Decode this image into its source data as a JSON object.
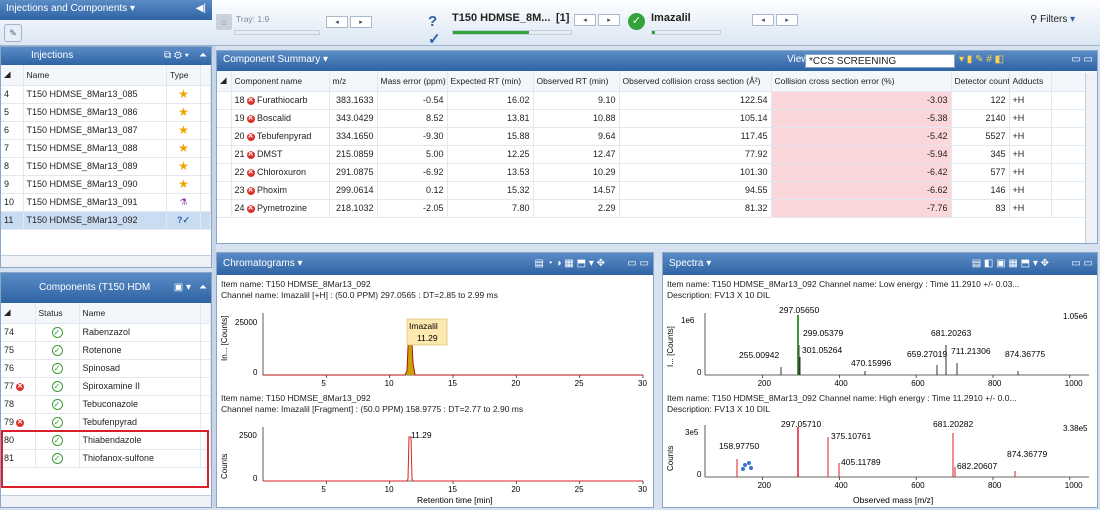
{
  "toolbar": {
    "tray_label": "Tray: 1:9",
    "injection_title": "T150 HDMSE_8M...",
    "injection_index": "[1]",
    "component_title": "Imazalil",
    "filters_label": "Filters"
  },
  "injections_panel": {
    "outer_title": "Injections and Components",
    "title": "Injections",
    "col_name": "Name",
    "col_type": "Type",
    "rows": [
      {
        "idx": "4",
        "name": "T150 HDMSE_8Mar13_085"
      },
      {
        "idx": "5",
        "name": "T150 HDMSE_8Mar13_086"
      },
      {
        "idx": "6",
        "name": "T150 HDMSE_8Mar13_087"
      },
      {
        "idx": "7",
        "name": "T150 HDMSE_8Mar13_088"
      },
      {
        "idx": "8",
        "name": "T150 HDMSE_8Mar13_089"
      },
      {
        "idx": "9",
        "name": "T150 HDMSE_8Mar13_090"
      },
      {
        "idx": "10",
        "name": "T150 HDMSE_8Mar13_091"
      },
      {
        "idx": "11",
        "name": "T150 HDMSE_8Mar13_092"
      }
    ]
  },
  "components_panel": {
    "title": "Components (T150 HDM",
    "col_status": "Status",
    "col_name": "Name",
    "rows": [
      {
        "idx": "74",
        "name": "Rabenzazol"
      },
      {
        "idx": "75",
        "name": "Rotenone"
      },
      {
        "idx": "76",
        "name": "Spinosad"
      },
      {
        "idx": "77",
        "name": "Spiroxamine II"
      },
      {
        "idx": "78",
        "name": "Tebuconazole"
      },
      {
        "idx": "79",
        "name": "Tebufenpyrad"
      },
      {
        "idx": "80",
        "name": "Thiabendazole"
      },
      {
        "idx": "81",
        "name": "Thiofanox-sulfone"
      }
    ]
  },
  "summary": {
    "title": "Component Summary",
    "view_label": "View:",
    "view_value": "*CCS SCREENING",
    "columns": [
      "Component name",
      "m/z",
      "Mass error (ppm)",
      "Expected RT (min)",
      "Observed RT (min)",
      "Observed collision cross section (Å²)",
      "Collision cross section error (%)",
      "Detector counts",
      "Adducts"
    ],
    "rows": [
      {
        "idx": "18",
        "name": "Furathiocarb",
        "mz": "383.1633",
        "me": "-0.54",
        "ert": "16.02",
        "ort": "9.10",
        "ccs": "122.54",
        "ccserr": "-3.03",
        "counts": "122",
        "adduct": "+H"
      },
      {
        "idx": "19",
        "name": "Boscalid",
        "mz": "343.0429",
        "me": "8.52",
        "ert": "13.81",
        "ort": "10.88",
        "ccs": "105.14",
        "ccserr": "-5.38",
        "counts": "2140",
        "adduct": "+H"
      },
      {
        "idx": "20",
        "name": "Tebufenpyrad",
        "mz": "334.1650",
        "me": "-9.30",
        "ert": "15.88",
        "ort": "9.64",
        "ccs": "117.45",
        "ccserr": "-5.42",
        "counts": "5527",
        "adduct": "+H"
      },
      {
        "idx": "21",
        "name": "DMST",
        "mz": "215.0859",
        "me": "5.00",
        "ert": "12.25",
        "ort": "12.47",
        "ccs": "77.92",
        "ccserr": "-5.94",
        "counts": "345",
        "adduct": "+H"
      },
      {
        "idx": "22",
        "name": "Chloroxuron",
        "mz": "291.0875",
        "me": "-6.92",
        "ert": "13.53",
        "ort": "10.29",
        "ccs": "101.30",
        "ccserr": "-6.42",
        "counts": "577",
        "adduct": "+H"
      },
      {
        "idx": "23",
        "name": "Phoxim",
        "mz": "299.0614",
        "me": "0.12",
        "ert": "15.32",
        "ort": "14.57",
        "ccs": "94.55",
        "ccserr": "-6.62",
        "counts": "146",
        "adduct": "+H"
      },
      {
        "idx": "24",
        "name": "Pymetrozine",
        "mz": "218.1032",
        "me": "-2.05",
        "ert": "7.80",
        "ort": "2.29",
        "ccs": "81.32",
        "ccserr": "-7.76",
        "counts": "83",
        "adduct": "+H"
      }
    ]
  },
  "chromatograms": {
    "title": "Chromatograms",
    "plot1": {
      "item": "Item name: T150 HDMSE_8Mar13_092",
      "channel": "Channel name: Imazalil [+H] : (50.0 PPM) 297.0565 : DT=2.85 to 2.99 ms",
      "ylabel": "In... [Counts]",
      "ytick": "25000",
      "yzero": "0",
      "peak_label": "Imazalil",
      "peak_value": "11.29"
    },
    "plot2": {
      "item": "Item name: T150 HDMSE_8Mar13_092",
      "channel": "Channel name: Imazalil [Fragment] : (50.0 PPM) 158.9775 : DT=2.77 to 2.90 ms",
      "ylabel": "Counts",
      "ytick": "2500",
      "yzero": "0",
      "peak_value": "11.29"
    },
    "xticks": [
      "5",
      "10",
      "15",
      "20",
      "25",
      "30"
    ],
    "xlabel": "Retention time [min]"
  },
  "spectra": {
    "title": "Spectra",
    "plot1": {
      "item": "Item name: T150 HDMSE_8Mar13_092   Channel name: Low energy : Time 11.2910 +/- 0.03...",
      "desc": "Description: FV13 X 10 DIL",
      "ylabel": "I... [Counts]",
      "ytick": "1e6",
      "yzero": "0",
      "max": "1.05e6",
      "labels": [
        "297.05650",
        "299.05379",
        "301.05264",
        "255.00942",
        "470.15996",
        "659.27019",
        "681.20263",
        "711.21306",
        "874.36775"
      ]
    },
    "plot2": {
      "item": "Item name: T150 HDMSE_8Mar13_092   Channel name: High energy : Time 11.2910 +/- 0.0...",
      "desc": "Description: FV13 X 10 DIL",
      "ylabel": "Counts",
      "ytick": "3e5",
      "yzero": "0",
      "max": "3.38e5",
      "labels": [
        "297.05710",
        "375.10761",
        "158.97750",
        "405.11789",
        "681.20282",
        "682.20607",
        "874.36779"
      ]
    },
    "xticks": [
      "200",
      "400",
      "600",
      "800",
      "1000"
    ],
    "xlabel": "Observed mass [m/z]"
  }
}
